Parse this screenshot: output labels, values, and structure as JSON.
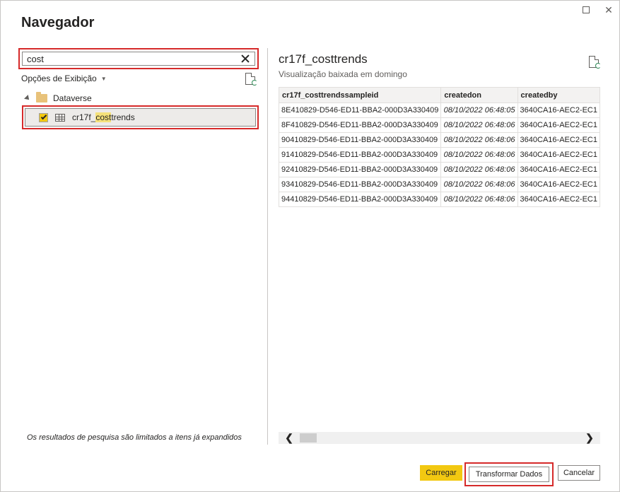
{
  "window": {
    "title": "Navegador",
    "maximize_label": "",
    "close_label": "✕"
  },
  "search": {
    "value": "cost"
  },
  "view_options": {
    "label": "Opções de Exibição",
    "caret": "▼"
  },
  "tree": {
    "folder": {
      "label": "Dataverse"
    },
    "item": {
      "label_prefix": "cr17f_",
      "label_match": "cost",
      "label_suffix": "trends",
      "checked": true
    }
  },
  "limit_note": "Os resultados de pesquisa são limitados a itens já expandidos",
  "preview": {
    "title": "cr17f_costtrends",
    "subtitle": "Visualização baixada em domingo",
    "columns": [
      "cr17f_costtrendssampleid",
      "createdon",
      "createdby"
    ],
    "rows": [
      [
        "8E410829-D546-ED11-BBA2-000D3A330409",
        "08/10/2022 06:48:05",
        "3640CA16-AEC2-EC1"
      ],
      [
        "8F410829-D546-ED11-BBA2-000D3A330409",
        "08/10/2022 06:48:06",
        "3640CA16-AEC2-EC1"
      ],
      [
        "90410829-D546-ED11-BBA2-000D3A330409",
        "08/10/2022 06:48:06",
        "3640CA16-AEC2-EC1"
      ],
      [
        "91410829-D546-ED11-BBA2-000D3A330409",
        "08/10/2022 06:48:06",
        "3640CA16-AEC2-EC1"
      ],
      [
        "92410829-D546-ED11-BBA2-000D3A330409",
        "08/10/2022 06:48:06",
        "3640CA16-AEC2-EC1"
      ],
      [
        "93410829-D546-ED11-BBA2-000D3A330409",
        "08/10/2022 06:48:06",
        "3640CA16-AEC2-EC1"
      ],
      [
        "94410829-D546-ED11-BBA2-000D3A330409",
        "08/10/2022 06:48:06",
        "3640CA16-AEC2-EC1"
      ]
    ],
    "scroll_left": "❮",
    "scroll_right": "❯"
  },
  "buttons": {
    "load": "Carregar",
    "transform": "Transformar Dados",
    "cancel": "Cancelar"
  },
  "colors": {
    "accent": "#f2c811",
    "highlight_outline": "#d62a2a",
    "search_match": "#f5e17a"
  }
}
